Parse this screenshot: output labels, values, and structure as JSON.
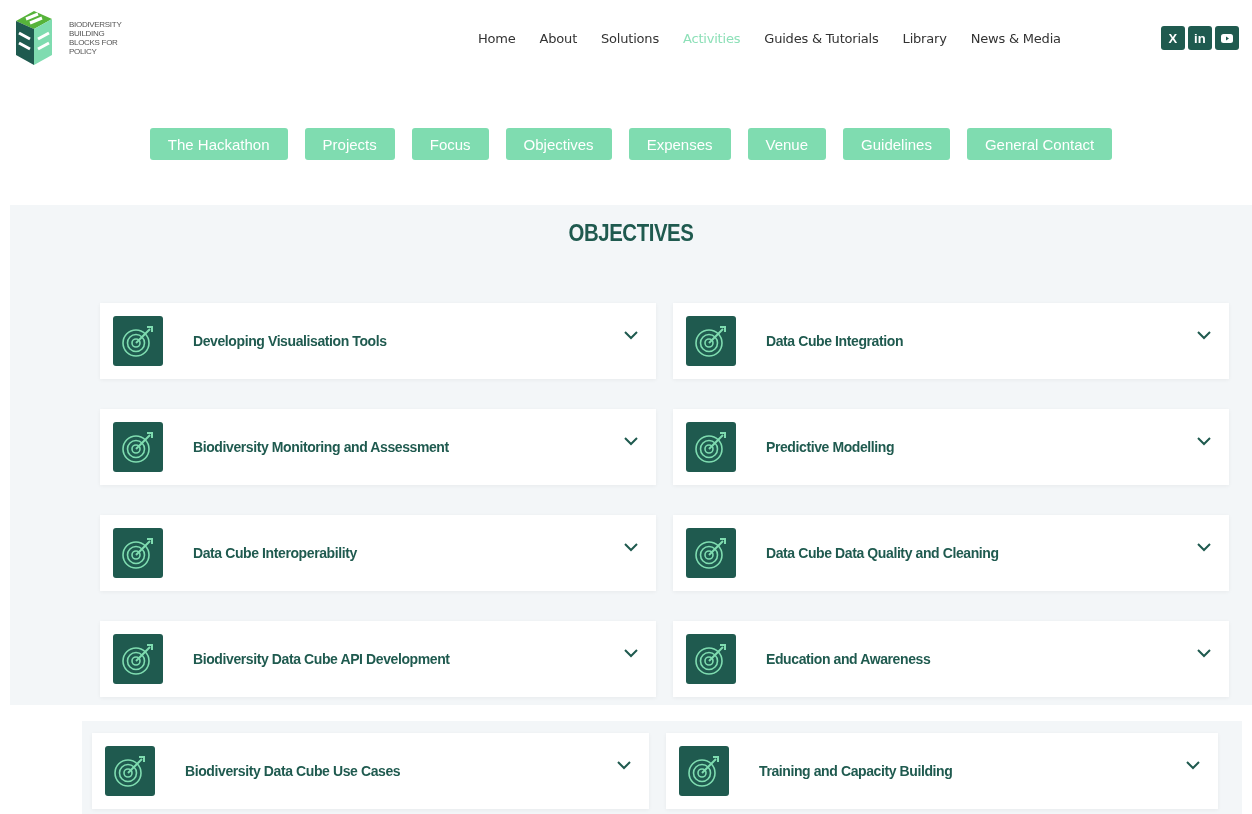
{
  "logo": {
    "lines": [
      "BIODIVERSITY",
      "BUILDING",
      "BLOCKS FOR",
      "POLICY"
    ]
  },
  "nav": [
    {
      "label": "Home",
      "selected": false
    },
    {
      "label": "About",
      "selected": false
    },
    {
      "label": "Solutions",
      "selected": false
    },
    {
      "label": "Activities",
      "selected": true
    },
    {
      "label": "Guides & Tutorials",
      "selected": false
    },
    {
      "label": "Library",
      "selected": false
    },
    {
      "label": "News & Media",
      "selected": false
    }
  ],
  "social": [
    {
      "kind": "x",
      "label": "X"
    },
    {
      "kind": "linkedin",
      "label": "in"
    },
    {
      "kind": "youtube"
    }
  ],
  "subnav": [
    "The Hackathon",
    "Projects",
    "Focus",
    "Objectives",
    "Expenses",
    "Venue",
    "Guidelines",
    "General Contact"
  ],
  "section": {
    "title": "OBJECTIVES"
  },
  "objectives": [
    {
      "title": "Developing Visualisation Tools",
      "expanded": false
    },
    {
      "title": "Data Cube Integration",
      "expanded": false
    },
    {
      "title": "Biodiversity Monitoring and Assessment",
      "expanded": false
    },
    {
      "title": "Predictive Modelling",
      "expanded": false
    },
    {
      "title": "Data Cube Interoperability",
      "expanded": false
    },
    {
      "title": "Data Cube Data Quality and Cleaning",
      "expanded": false
    },
    {
      "title": "Biodiversity Data Cube API Development",
      "expanded": false
    },
    {
      "title": "Education and Awareness",
      "expanded": false
    }
  ],
  "more_objectives": [
    {
      "title": "Biodiversity Data Cube Use Cases",
      "expanded": false
    },
    {
      "title": "Training and Capacity Building",
      "expanded": false
    }
  ]
}
